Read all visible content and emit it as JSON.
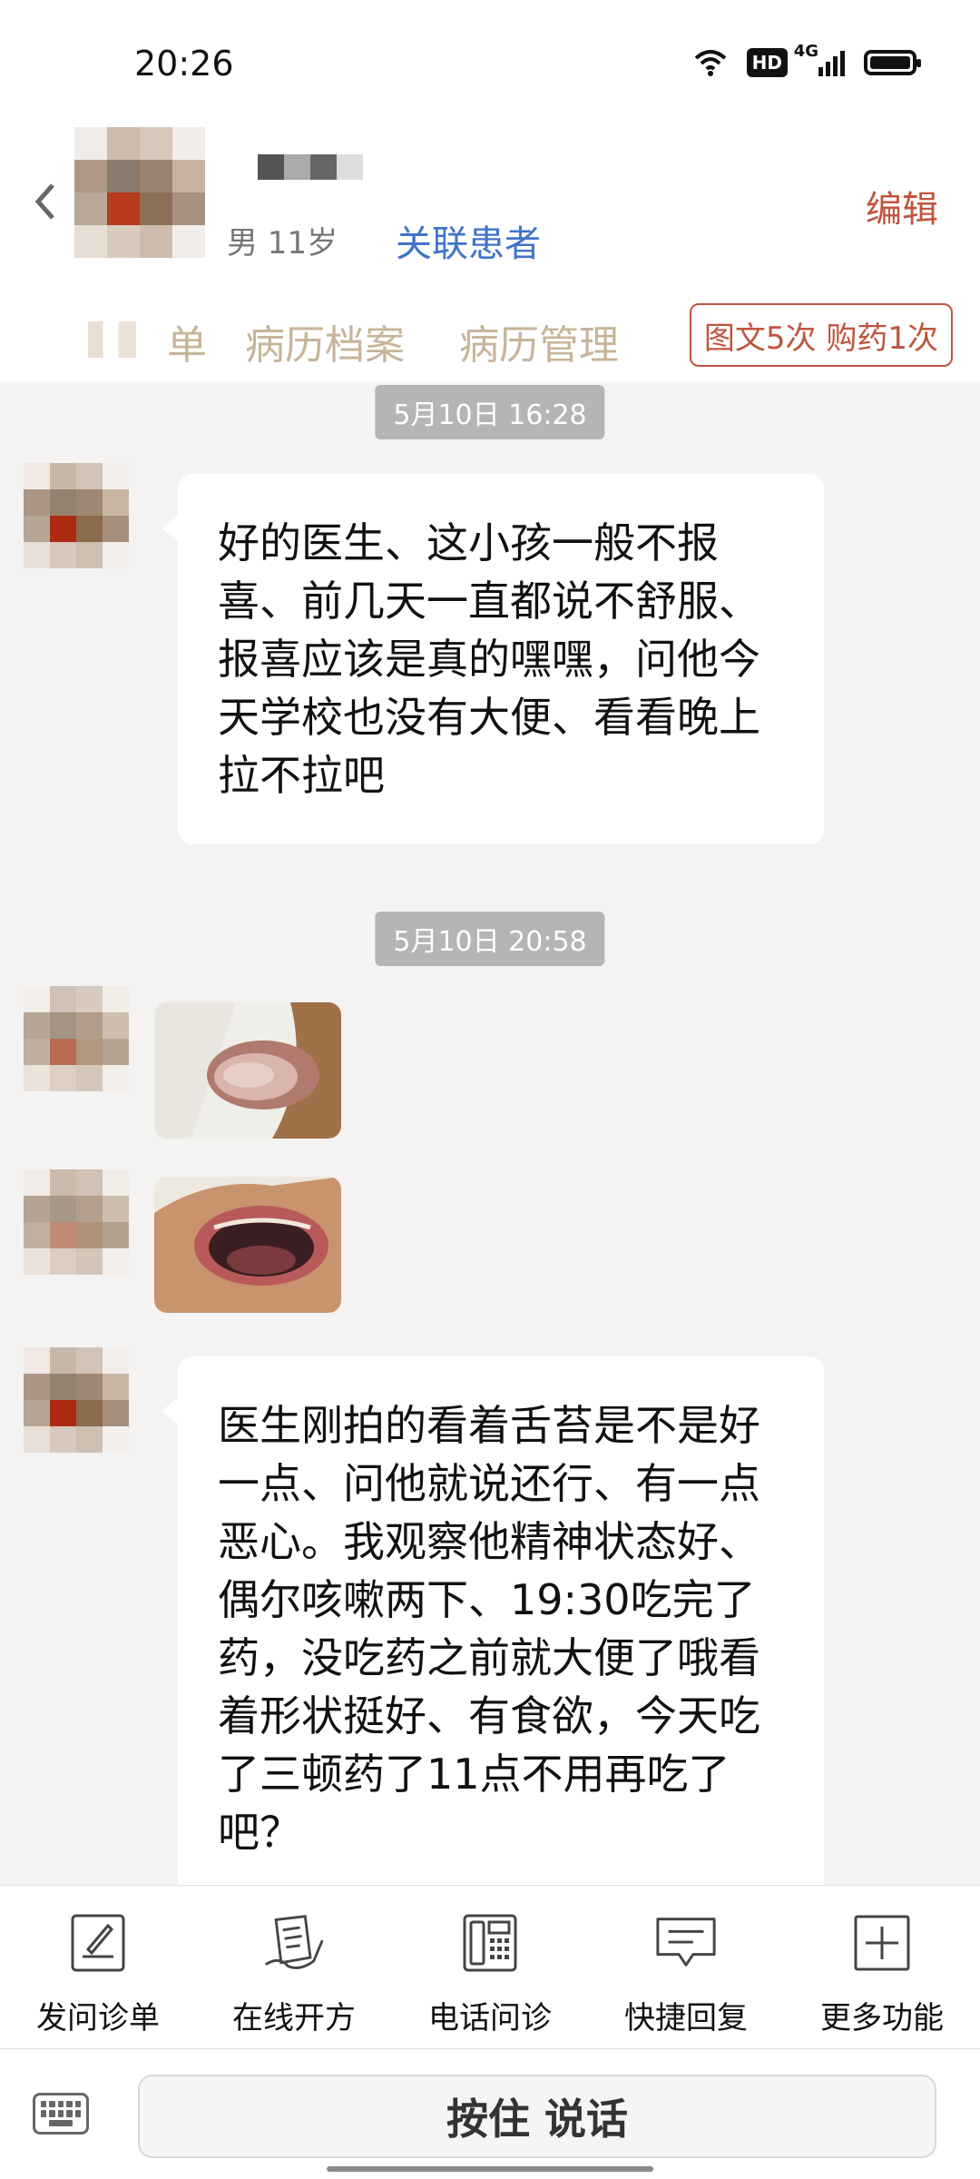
{
  "status_bar": {
    "time": "20:26",
    "hd": "HD",
    "network": "4G"
  },
  "header": {
    "patient_meta": "男 11岁",
    "link_patient": "关联患者",
    "edit": "编辑",
    "tabs": [
      {
        "label": "单"
      },
      {
        "label": "病历档案"
      },
      {
        "label": "病历管理"
      }
    ],
    "counter": "图文5次 购药1次"
  },
  "messages": [
    {
      "type": "timestamp",
      "text": "5月10日 16:28"
    },
    {
      "type": "text",
      "text": "好的医生、这小孩一般不报喜、前几天一直都说不舒服、报喜应该是真的嘿嘿，问他今天学校也没有大便、看看晚上拉不拉吧"
    },
    {
      "type": "timestamp",
      "text": "5月10日 20:58"
    },
    {
      "type": "image",
      "icon": "tongue-photo"
    },
    {
      "type": "image",
      "icon": "mouth-photo"
    },
    {
      "type": "text",
      "text": "医生刚拍的看着舌苔是不是好一点、问他就说还行、有一点恶心。我观察他精神状态好、偶尔咳嗽两下、19:30吃完了药，没吃药之前就大便了哦看着形状挺好、有食欲，今天吃了三顿药了11点不用再吃了吧？"
    }
  ],
  "toolbar": [
    {
      "label": "发问诊单",
      "icon": "form-icon"
    },
    {
      "label": "在线开方",
      "icon": "prescription-icon"
    },
    {
      "label": "电话问诊",
      "icon": "phone-icon"
    },
    {
      "label": "快捷回复",
      "icon": "quick-reply-icon"
    },
    {
      "label": "更多功能",
      "icon": "plus-icon"
    }
  ],
  "input": {
    "talk_label": "按住 说话"
  },
  "colors": {
    "accent": "#c0543d",
    "link": "#3f74c9",
    "tab": "#c8b49a"
  }
}
